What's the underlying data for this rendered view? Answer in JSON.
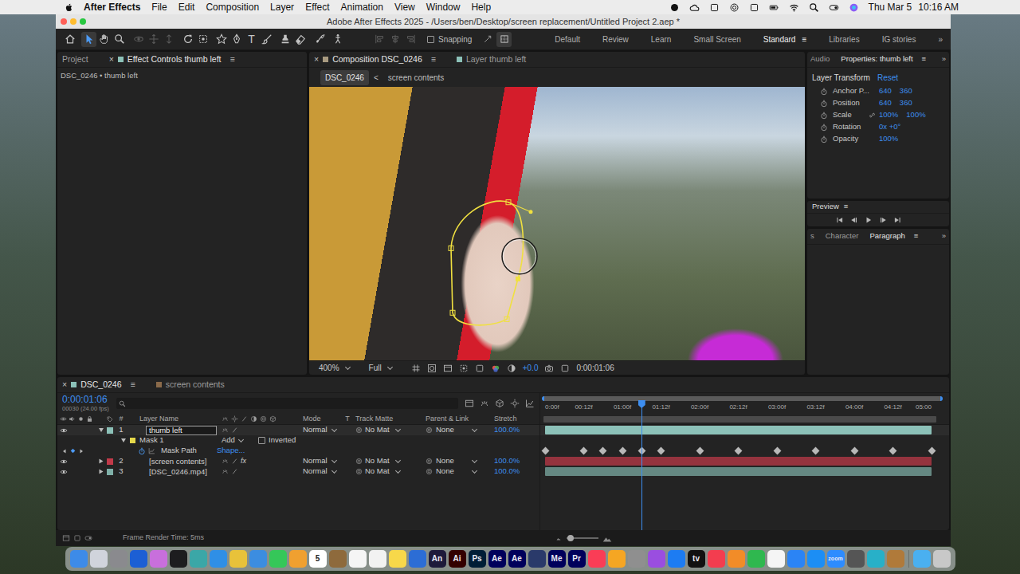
{
  "menubar": {
    "app": "After Effects",
    "menus": [
      "File",
      "Edit",
      "Composition",
      "Layer",
      "Effect",
      "Animation",
      "View",
      "Window",
      "Help"
    ],
    "date": "Thu Mar 5",
    "time": "10:16 AM"
  },
  "window": {
    "title": "Adobe After Effects 2025 - /Users/ben/Desktop/screen replacement/Untitled Project 2.aep *"
  },
  "toolbar": {
    "tools": [
      {
        "kind": "home",
        "selected": false,
        "disabled": false
      },
      {
        "kind": "select",
        "selected": true,
        "disabled": false
      },
      {
        "kind": "hand",
        "selected": false,
        "disabled": false
      },
      {
        "kind": "zoom",
        "selected": false,
        "disabled": false
      },
      {
        "kind": "orbit",
        "selected": false,
        "disabled": true
      },
      {
        "kind": "pan",
        "selected": false,
        "disabled": true
      },
      {
        "kind": "dolly",
        "selected": false,
        "disabled": true
      },
      {
        "kind": "rotate",
        "selected": false,
        "disabled": false
      },
      {
        "kind": "anchor",
        "selected": false,
        "disabled": false
      },
      {
        "kind": "shape",
        "selected": false,
        "disabled": false
      },
      {
        "kind": "pen",
        "selected": false,
        "disabled": false
      },
      {
        "kind": "type",
        "selected": false,
        "disabled": false,
        "glyph": "T"
      },
      {
        "kind": "brush",
        "selected": false,
        "disabled": false
      },
      {
        "kind": "stamp",
        "selected": false,
        "disabled": false
      },
      {
        "kind": "eraser",
        "selected": false,
        "disabled": false
      },
      {
        "kind": "roto",
        "selected": false,
        "disabled": false
      },
      {
        "kind": "puppet",
        "selected": false,
        "disabled": false
      },
      {
        "kind": "align1",
        "selected": false,
        "disabled": true
      },
      {
        "kind": "align2",
        "selected": false,
        "disabled": true
      },
      {
        "kind": "align3",
        "selected": false,
        "disabled": true
      }
    ],
    "snapping": {
      "label": "Snapping",
      "checked": false
    },
    "snap_options": [
      {
        "kind": "snapedge",
        "selected": false
      },
      {
        "kind": "snapgrid",
        "selected": true
      }
    ],
    "workspaces": [
      {
        "label": "Default",
        "selected": false
      },
      {
        "label": "Review",
        "selected": false
      },
      {
        "label": "Learn",
        "selected": false
      },
      {
        "label": "Small Screen",
        "selected": false
      },
      {
        "label": "Standard",
        "selected": true,
        "menu": "≡"
      },
      {
        "label": "Libraries",
        "selected": false
      },
      {
        "label": "IG stories",
        "selected": false
      }
    ],
    "more": "»"
  },
  "project_panel": {
    "tabs": [
      {
        "label": "Project",
        "selected": false
      },
      {
        "label": "Effect Controls thumb left",
        "selected": true,
        "close": "×",
        "menu": "≡",
        "color": "#8cc1b8"
      }
    ],
    "subtitle": "DSC_0246 • thumb left"
  },
  "comp_panel": {
    "tabs": [
      {
        "label": "Composition DSC_0246",
        "selected": true,
        "close": "×",
        "menu": "≡",
        "color": "#a89a80"
      },
      {
        "label": "Layer thumb left",
        "selected": false,
        "color": "#8cc1b8"
      }
    ],
    "nav": [
      {
        "label": "DSC_0246",
        "selected": true
      },
      {
        "label": "screen contents",
        "selected": false
      }
    ],
    "nav_arrow": "<",
    "footer": {
      "zoom": "400%",
      "resolution": "Full",
      "exposure": "+0.0",
      "timecode": "0:00:01:06"
    }
  },
  "properties_panel": {
    "tabs": [
      {
        "label": "Audio",
        "selected": false
      },
      {
        "label": "Properties: thumb left",
        "selected": true,
        "menu": "≡"
      }
    ],
    "more": "»",
    "section": "Layer Transform",
    "reset": "Reset",
    "rows": [
      {
        "label": "Anchor P...",
        "values": [
          "640",
          "360"
        ],
        "linked": false
      },
      {
        "label": "Position",
        "values": [
          "640",
          "360"
        ],
        "linked": false
      },
      {
        "label": "Scale",
        "values": [
          "100%",
          "100%"
        ],
        "linked": true
      },
      {
        "label": "Rotation",
        "values": [
          "0x +0°"
        ],
        "linked": false
      },
      {
        "label": "Opacity",
        "values": [
          "100%"
        ],
        "linked": false
      }
    ]
  },
  "preview_panel": {
    "title": "Preview",
    "menu": "≡",
    "controls": [
      {
        "kind": "first"
      },
      {
        "kind": "back"
      },
      {
        "kind": "play"
      },
      {
        "kind": "forward"
      },
      {
        "kind": "last"
      }
    ]
  },
  "type_panel": {
    "tabs": [
      {
        "label": "s",
        "selected": false
      },
      {
        "label": "Character",
        "selected": false
      },
      {
        "label": "Paragraph",
        "selected": true,
        "menu": "≡"
      }
    ],
    "more": "»"
  },
  "timeline": {
    "tabs": [
      {
        "label": "DSC_0246",
        "selected": true,
        "close": "×",
        "menu": "≡",
        "color": "#8cc1b8"
      },
      {
        "label": "screen contents",
        "selected": false,
        "color": "#8a6a4a"
      }
    ],
    "timecode": "0:00:01:06",
    "frame_info": "00030 (24.00 fps)",
    "columns": [
      "#",
      "Layer Name",
      "Mode",
      "T",
      "Track Matte",
      "Parent & Link",
      "Stretch"
    ],
    "ruler": [
      "0:00f",
      "00:12f",
      "01:00f",
      "01:12f",
      "02:00f",
      "02:12f",
      "03:00f",
      "03:12f",
      "04:00f",
      "04:12f",
      "05:00"
    ],
    "duration_frames": 120,
    "playhead_frame": 30,
    "layers": [
      {
        "kind": "layer",
        "index": "1",
        "name": "thumb left",
        "color": "#8cc1b8",
        "visible": true,
        "expanded": true,
        "selected": true,
        "mode": "Normal",
        "matte": "No Mat",
        "parent": "None",
        "stretch": "100.0%"
      },
      {
        "kind": "mask",
        "name": "Mask 1",
        "color": "#e5d84a",
        "expanded": true,
        "mode": "Add",
        "inverted_label": "Inverted",
        "inverted": false
      },
      {
        "kind": "property",
        "name": "Mask Path",
        "value": "Shape...",
        "animated": true,
        "keyframes": [
          0,
          12,
          18,
          24,
          30,
          36,
          48,
          60,
          72,
          84,
          96,
          108,
          120
        ]
      },
      {
        "kind": "layer",
        "index": "2",
        "name": "[screen contents]",
        "color": "#c23a4a",
        "visible": true,
        "expanded": false,
        "selected": false,
        "fx": "fx",
        "mode": "Normal",
        "matte": "No Mat",
        "parent": "None",
        "stretch": "100.0%"
      },
      {
        "kind": "layer",
        "index": "3",
        "name": "[DSC_0246.mp4]",
        "color": "#7fb0a8",
        "visible": true,
        "expanded": false,
        "selected": false,
        "mode": "Normal",
        "matte": "No Mat",
        "parent": "None",
        "stretch": "100.0%"
      }
    ]
  },
  "status": {
    "render": "Frame Render Time: 5ms",
    "zoom_level": 0.12
  },
  "dock": [
    {
      "color": "#3d8be8"
    },
    {
      "color": "#d0d4dc"
    },
    {
      "color": "#8a8a8e"
    },
    {
      "color": "#1c5fd4"
    },
    {
      "color": "#c86fdc"
    },
    {
      "color": "#1d1d1f"
    },
    {
      "color": "#3ba7a7"
    },
    {
      "color": "#2f8fe6"
    },
    {
      "color": "#e8c23a"
    },
    {
      "color": "#3c8de0"
    },
    {
      "color": "#35c759"
    },
    {
      "color": "#f0a030"
    },
    {
      "color": "#ffffff",
      "label": "5"
    },
    {
      "color": "#8e6a3c"
    },
    {
      "color": "#f5f5f5"
    },
    {
      "color": "#f2f2f2"
    },
    {
      "color": "#f7d84a"
    },
    {
      "color": "#2c6dd5"
    },
    {
      "color": "#1e1a3a",
      "label": "An"
    },
    {
      "color": "#330000",
      "label": "Ai"
    },
    {
      "color": "#001e36",
      "label": "Ps"
    },
    {
      "color": "#00005b",
      "label": "Ae"
    },
    {
      "color": "#00005b",
      "label": "Ae"
    },
    {
      "color": "#2a3a6a"
    },
    {
      "color": "#00005b",
      "label": "Me"
    },
    {
      "color": "#00005b",
      "label": "Pr"
    },
    {
      "color": "#fa3d56"
    },
    {
      "color": "#f5a623"
    },
    {
      "color": "#8f8f8f"
    },
    {
      "color": "#9a4ee0"
    },
    {
      "color": "#1d7cf2"
    },
    {
      "color": "#111111",
      "label": "tv"
    },
    {
      "color": "#f33d4f"
    },
    {
      "color": "#f28c28"
    },
    {
      "color": "#2fb84f"
    },
    {
      "color": "#f5f5f5"
    },
    {
      "color": "#2b84f5"
    },
    {
      "color": "#1c8ef5"
    },
    {
      "color": "#2d8cff",
      "label": "zoom"
    },
    {
      "color": "#555555"
    },
    {
      "color": "#28b0c8"
    },
    {
      "color": "#b07a3a"
    },
    {
      "color": "#4ab0f0"
    },
    {
      "color": "#c8c8c8"
    }
  ]
}
